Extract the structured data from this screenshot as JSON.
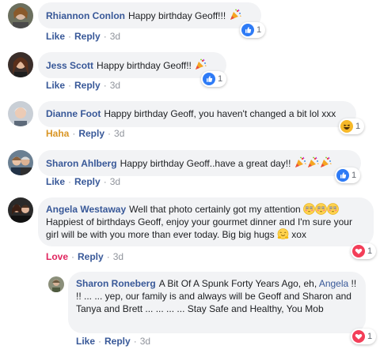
{
  "actions": {
    "like": "Like",
    "reply": "Reply",
    "haha": "Haha",
    "love": "Love",
    "sep": "·"
  },
  "comments": [
    {
      "author": "Rhiannon Conlon",
      "text": "Happy birthday Geoff!!!",
      "time": "3d",
      "reaction": "like",
      "count": "1",
      "reaction_label": "Like"
    },
    {
      "author": "Jess Scott",
      "text": "Happy birthday Geoff!!",
      "time": "3d",
      "reaction": "like",
      "count": "1",
      "reaction_label": "Like"
    },
    {
      "author": "Dianne Foot",
      "text": "Happy birthday Geoff, you haven't changed a bit lol xxx",
      "time": "3d",
      "reaction": "haha",
      "count": "1",
      "reaction_label": "Haha"
    },
    {
      "author": "Sharon Ahlberg",
      "text": "Happy birthday Geoff..have a great day!!",
      "time": "3d",
      "reaction": "like",
      "count": "1",
      "reaction_label": "Like"
    },
    {
      "author": "Angela Westaway",
      "text": "Well that photo certainly got my attention",
      "text2": "Happiest of birthdays Geoff, enjoy your gourmet dinner and I'm sure your girl will be with you more than ever today. Big big hugs",
      "text3": "xox",
      "time": "3d",
      "reaction": "love",
      "count": "1",
      "reaction_label": "Love"
    }
  ],
  "reply": {
    "author": "Sharon Roneberg",
    "text": "A Bit Of A Spunk Forty Years Ago, eh,",
    "mention": "Angela",
    "text2": "!! !! ... ... yep, our family is and always will be Geoff and Sharon and Tanya and Brett ... ... ... ... Stay Safe and Healthy, You Mob",
    "time": "3d",
    "reaction": "love",
    "count": "1",
    "reaction_label": "Like"
  },
  "colors": {
    "link": "#385898",
    "bubble": "#f2f3f5",
    "like": "#2e7bf6",
    "haha": "#f7b928",
    "love": "#f33e58",
    "time": "#90949c"
  },
  "icons": [
    "party-popper-icon",
    "like-reaction-icon",
    "haha-reaction-icon",
    "love-reaction-icon",
    "flushed-face-icon",
    "hugging-face-icon"
  ]
}
